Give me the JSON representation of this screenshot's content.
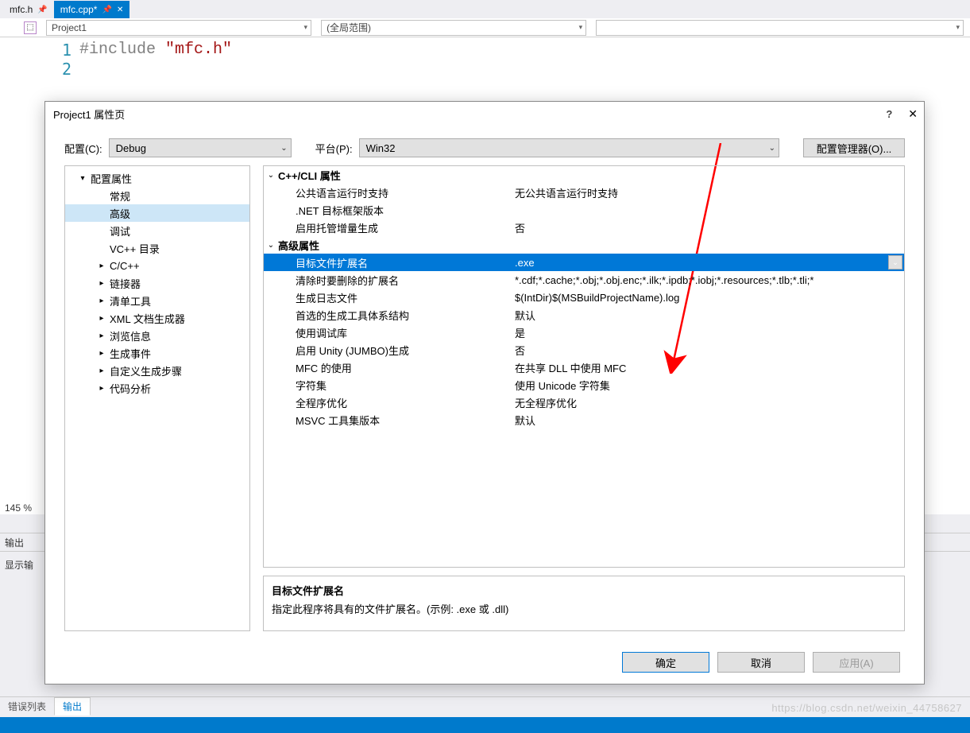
{
  "editor": {
    "tabs": [
      {
        "label": "mfc.h",
        "pinned": true,
        "active": false
      },
      {
        "label": "mfc.cpp*",
        "pinned": true,
        "active": true
      }
    ],
    "scope_left": "Project1",
    "scope_right": "(全局范围)",
    "code_line1_include": "#include ",
    "code_line1_str": "\"mfc.h\"",
    "line_no_1": "1",
    "line_no_2": "2",
    "zoom": "145 %",
    "output_label": "输出",
    "show_output_from": "显示输",
    "bottom_tabs": {
      "error_list": "错误列表",
      "output": "输出"
    }
  },
  "dialog": {
    "title": "Project1 属性页",
    "config_label": "配置(C):",
    "config_value": "Debug",
    "platform_label": "平台(P):",
    "platform_value": "Win32",
    "config_mgr_btn": "配置管理器(O)...",
    "tree": [
      {
        "label": "配置属性",
        "level": 1,
        "state": "exp"
      },
      {
        "label": "常规",
        "level": 2,
        "state": "leaf"
      },
      {
        "label": "高级",
        "level": 2,
        "state": "leaf",
        "selected": true
      },
      {
        "label": "调试",
        "level": 2,
        "state": "leaf"
      },
      {
        "label": "VC++ 目录",
        "level": 2,
        "state": "leaf"
      },
      {
        "label": "C/C++",
        "level": 2,
        "state": "col"
      },
      {
        "label": "链接器",
        "level": 2,
        "state": "col"
      },
      {
        "label": "清单工具",
        "level": 2,
        "state": "col"
      },
      {
        "label": "XML 文档生成器",
        "level": 2,
        "state": "col"
      },
      {
        "label": "浏览信息",
        "level": 2,
        "state": "col"
      },
      {
        "label": "生成事件",
        "level": 2,
        "state": "col"
      },
      {
        "label": "自定义生成步骤",
        "level": 2,
        "state": "col"
      },
      {
        "label": "代码分析",
        "level": 2,
        "state": "col"
      }
    ],
    "groups": [
      {
        "title": "C++/CLI 属性",
        "rows": [
          {
            "key": "公共语言运行时支持",
            "val": "无公共语言运行时支持"
          },
          {
            "key": ".NET 目标框架版本",
            "val": ""
          },
          {
            "key": "启用托管增量生成",
            "val": "否"
          }
        ]
      },
      {
        "title": "高级属性",
        "rows": [
          {
            "key": "目标文件扩展名",
            "val": ".exe",
            "selected": true,
            "dropdown": true
          },
          {
            "key": "清除时要删除的扩展名",
            "val": "*.cdf;*.cache;*.obj;*.obj.enc;*.ilk;*.ipdb;*.iobj;*.resources;*.tlb;*.tli;*"
          },
          {
            "key": "生成日志文件",
            "val": "$(IntDir)$(MSBuildProjectName).log"
          },
          {
            "key": "首选的生成工具体系结构",
            "val": "默认"
          },
          {
            "key": "使用调试库",
            "val": "是"
          },
          {
            "key": "启用 Unity (JUMBO)生成",
            "val": "否"
          },
          {
            "key": "MFC 的使用",
            "val": "在共享 DLL 中使用 MFC"
          },
          {
            "key": "字符集",
            "val": "使用 Unicode 字符集"
          },
          {
            "key": "全程序优化",
            "val": "无全程序优化"
          },
          {
            "key": "MSVC 工具集版本",
            "val": "默认"
          }
        ]
      }
    ],
    "desc_title": "目标文件扩展名",
    "desc_text": "指定此程序将具有的文件扩展名。(示例: .exe 或 .dll)",
    "buttons": {
      "ok": "确定",
      "cancel": "取消",
      "apply": "应用(A)"
    }
  },
  "watermark": "https://blog.csdn.net/weixin_44758627"
}
